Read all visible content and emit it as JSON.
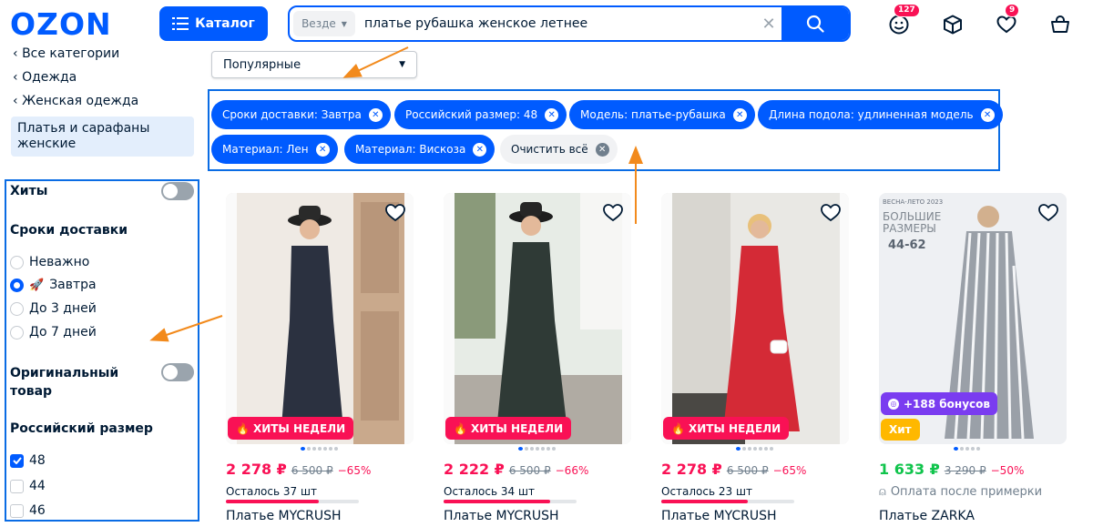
{
  "header": {
    "logo_text": "OZON",
    "catalog_label": "Каталог",
    "search_scope": "Везде",
    "search_query": "платье рубашка женское летнее",
    "icons": [
      {
        "name": "profile-icon",
        "badge": "127"
      },
      {
        "name": "orders-box-icon",
        "badge": ""
      },
      {
        "name": "favorites-heart-icon",
        "badge": "9"
      },
      {
        "name": "cart-icon",
        "badge": ""
      }
    ],
    "accent_color": "#005bff"
  },
  "breadcrumbs": [
    "Все категории",
    "Одежда",
    "Женская одежда"
  ],
  "current_category": "Платья и сарафаны женские",
  "sort": {
    "selected": "Популярные"
  },
  "filters": {
    "hits_label": "Хиты",
    "delivery": {
      "title": "Сроки доставки",
      "options": [
        "Неважно",
        "Завтра",
        "До 3 дней",
        "До 7 дней"
      ],
      "selected": "Завтра"
    },
    "original_label": "Оригинальный товар",
    "size": {
      "title": "Российский размер",
      "options": [
        {
          "label": "48",
          "checked": true
        },
        {
          "label": "44",
          "checked": false
        },
        {
          "label": "46",
          "checked": false
        }
      ]
    }
  },
  "active_filters": [
    "Сроки доставки: Завтра",
    "Российский размер: 48",
    "Модель: платье-рубашка",
    "Длина подола: удлиненная модель",
    "Материал: Лен",
    "Материал: Вискоза"
  ],
  "clear_all_label": "Очистить всё",
  "products": [
    {
      "badge": "ХИТЫ НЕДЕЛИ",
      "price": "2 278 ₽",
      "old_price": "6 500 ₽",
      "discount": "−65%",
      "stock": "Осталось 37 шт",
      "stock_fill": 0.7,
      "name": "Платье MYCRUSH",
      "dress_color": "#2b3140"
    },
    {
      "badge": "ХИТЫ НЕДЕЛИ",
      "price": "2 222 ₽",
      "old_price": "6 500 ₽",
      "discount": "−66%",
      "stock": "Осталось 34 шт",
      "stock_fill": 0.8,
      "name": "Платье MYCRUSH",
      "dress_color": "#2f3a36"
    },
    {
      "badge": "ХИТЫ НЕДЕЛИ",
      "price": "2 278 ₽",
      "old_price": "6 500 ₽",
      "discount": "−65%",
      "stock": "Осталось 23 шт",
      "stock_fill": 0.65,
      "name": "Платье MYCRUSH",
      "dress_color": "#d42a36"
    },
    {
      "bonus": "+188 бонусов",
      "hit": "Хит",
      "promo_season": "ВЕСНА-ЛЕТО 2023",
      "promo_title": "БОЛЬШИЕ РАЗМЕРЫ",
      "promo_sizes": "44-62",
      "price": "1 633 ₽",
      "old_price": "3 290 ₽",
      "discount": "−50%",
      "note": "Оплата после примерки",
      "name": "Платье ZARKA",
      "dress_color": "#9aa0a8"
    }
  ]
}
